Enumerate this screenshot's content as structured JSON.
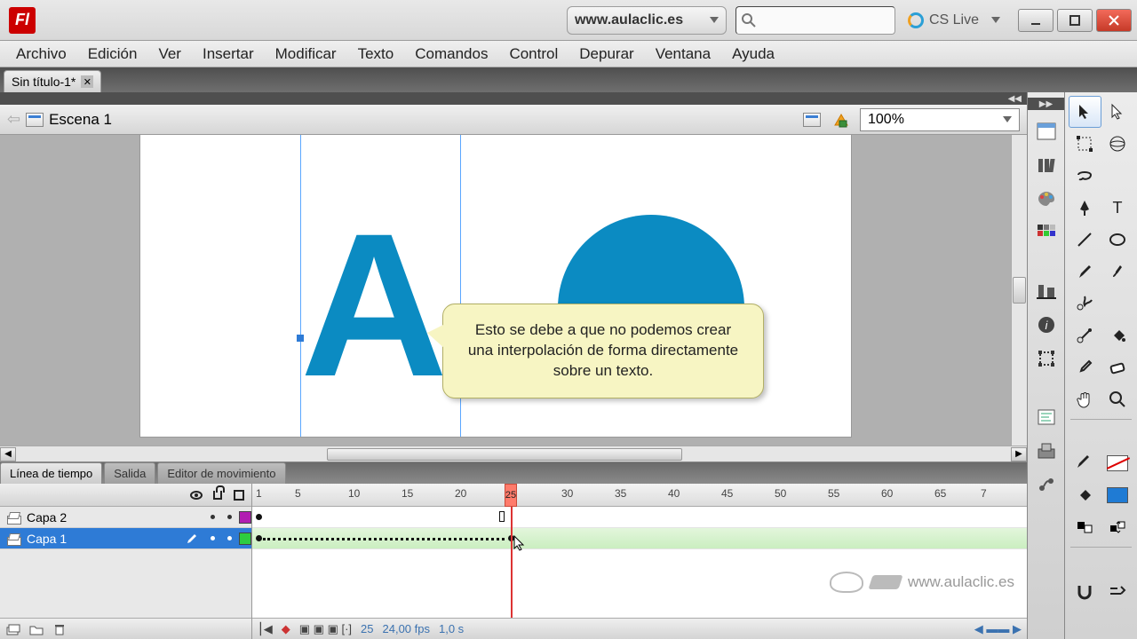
{
  "titlebar": {
    "url_label": "www.aulaclic.es",
    "cs_live": "CS Live"
  },
  "menu": [
    "Archivo",
    "Edición",
    "Ver",
    "Insertar",
    "Modificar",
    "Texto",
    "Comandos",
    "Control",
    "Depurar",
    "Ventana",
    "Ayuda"
  ],
  "doc_tab": {
    "title": "Sin título-1*"
  },
  "scene": {
    "label": "Escena 1",
    "zoom": "100%"
  },
  "stage": {
    "letter": "A",
    "callout": "Esto se debe a que no podemos crear una interpolación de forma directamente sobre un texto."
  },
  "timeline": {
    "tabs": [
      "Línea de tiempo",
      "Salida",
      "Editor de movimiento"
    ],
    "ruler": [
      "1",
      "5",
      "10",
      "15",
      "20",
      "25",
      "30",
      "35",
      "40",
      "45",
      "50",
      "55",
      "60",
      "65",
      "7"
    ],
    "layers": [
      {
        "name": "Capa 2",
        "swatch": "#b21eb2"
      },
      {
        "name": "Capa 1",
        "swatch": "#2ecc40"
      }
    ],
    "playhead_frame": "25",
    "foot": {
      "frame": "25",
      "fps": "24,00 fps",
      "time": "1,0 s"
    }
  },
  "watermark": "www.aulaclic.es"
}
